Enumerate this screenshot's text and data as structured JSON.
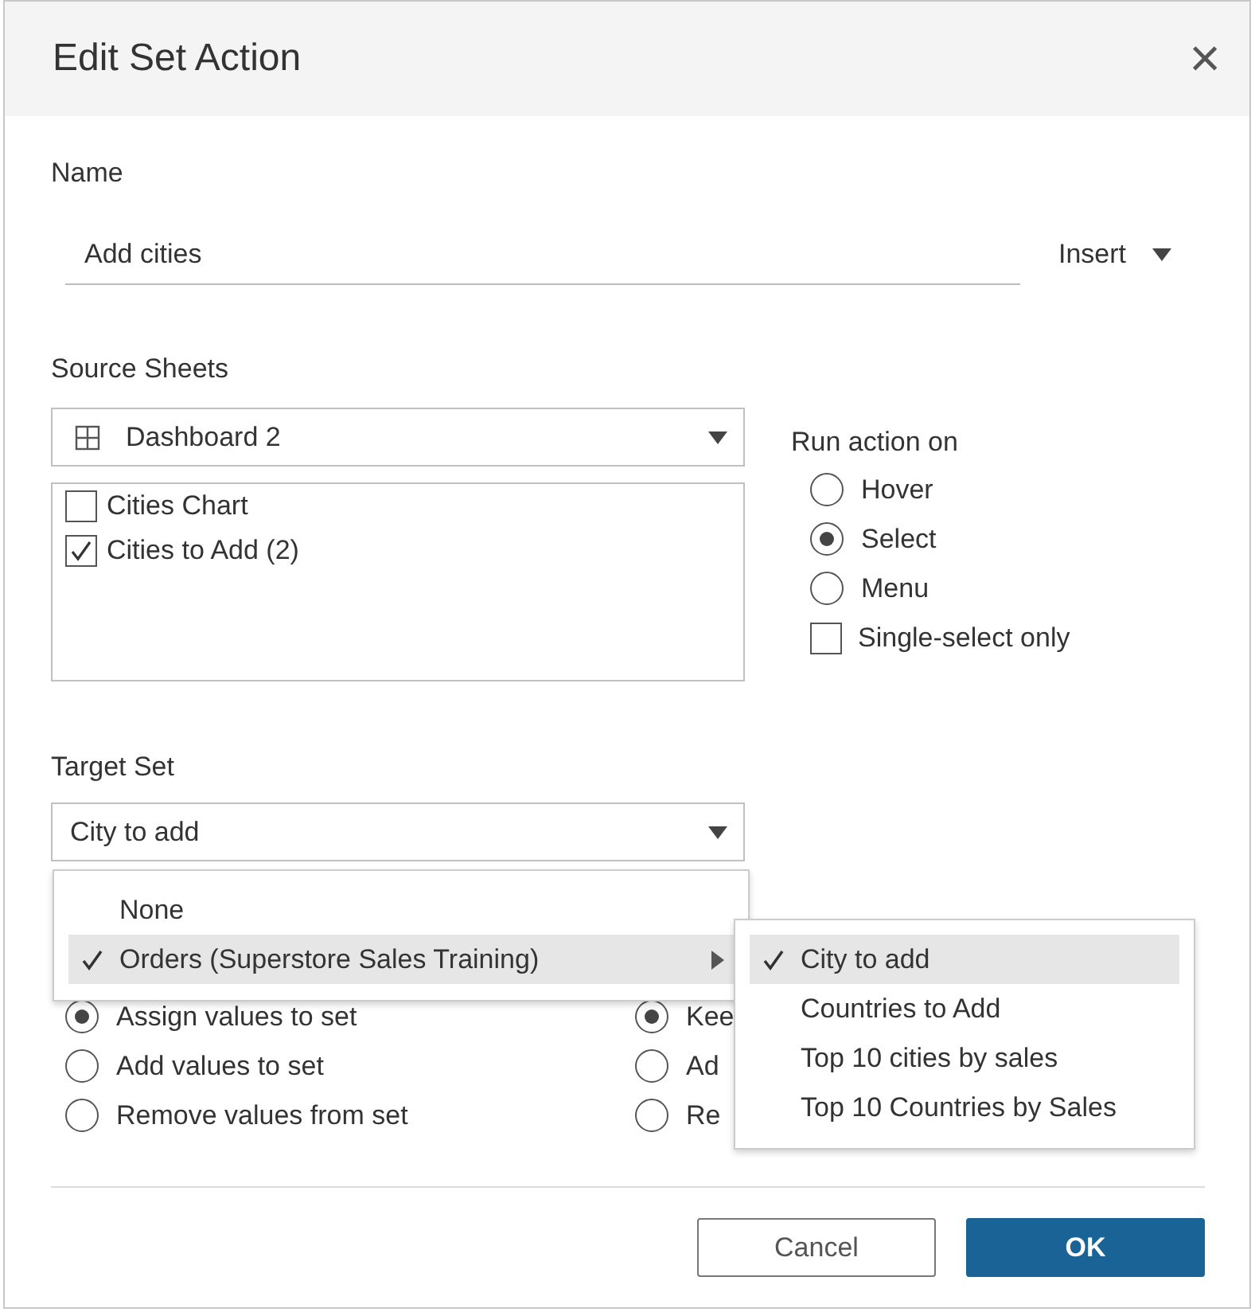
{
  "window": {
    "title": "Edit Set Action",
    "close": "×"
  },
  "name": {
    "label": "Name",
    "value": "Add cities",
    "insert": "Insert"
  },
  "source": {
    "label": "Source Sheets",
    "selected_sheet": "Dashboard 2",
    "sheets": [
      {
        "label": "Cities Chart",
        "checked": false
      },
      {
        "label": "Cities to Add (2)",
        "checked": true
      }
    ]
  },
  "run_action": {
    "label": "Run action on",
    "options": [
      {
        "label": "Hover",
        "selected": false
      },
      {
        "label": "Select",
        "selected": true
      },
      {
        "label": "Menu",
        "selected": false
      }
    ],
    "single_select": {
      "label": "Single-select only",
      "checked": false
    }
  },
  "target": {
    "label": "Target Set",
    "value": "City to add",
    "menu": [
      {
        "label": "None",
        "checked": false,
        "highlighted": false,
        "submenu": false
      },
      {
        "label": "Orders (Superstore Sales Training)",
        "checked": true,
        "highlighted": true,
        "submenu": true
      }
    ],
    "submenu": [
      {
        "label": "City to add",
        "checked": true,
        "highlighted": true
      },
      {
        "label": "Countries to Add",
        "checked": false,
        "highlighted": false
      },
      {
        "label": "Top 10 cities by sales",
        "checked": false,
        "highlighted": false
      },
      {
        "label": "Top 10 Countries by Sales",
        "checked": false,
        "highlighted": false
      }
    ]
  },
  "run_options": [
    {
      "label": "Assign values to set",
      "selected": true
    },
    {
      "label": "Add values to set",
      "selected": false
    },
    {
      "label": "Remove values from set",
      "selected": false
    }
  ],
  "clear_options": [
    {
      "label": "Kee",
      "selected": true
    },
    {
      "label": "Ad",
      "selected": false
    },
    {
      "label": "Re",
      "selected": false
    }
  ],
  "buttons": [
    {
      "label": "Cancel",
      "kind": "secondary"
    },
    {
      "label": "OK",
      "kind": "primary"
    }
  ]
}
